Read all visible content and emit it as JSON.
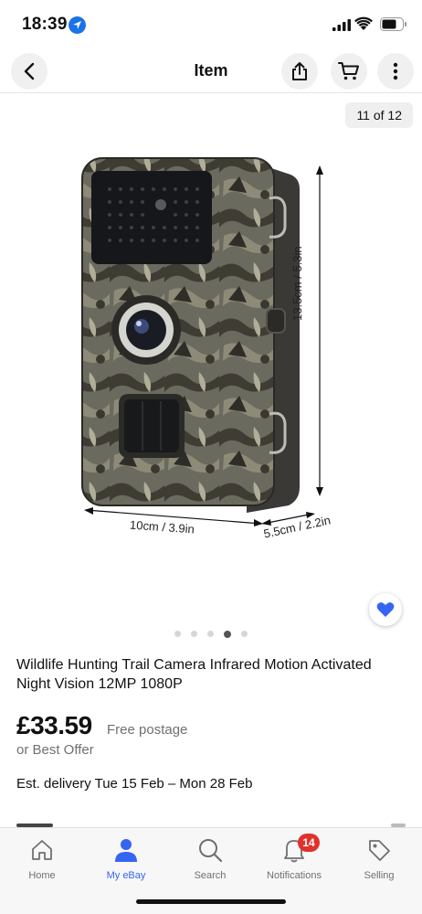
{
  "status_bar": {
    "time": "18:39"
  },
  "nav": {
    "title": "Item"
  },
  "gallery": {
    "counter": "11 of 12",
    "dimension_height": "13.5cm / 5.3in",
    "dimension_width": "10cm / 3.9in",
    "dimension_depth": "5.5cm / 2.2in",
    "dots_total": 5,
    "dots_active_index": 3
  },
  "listing": {
    "title": "Wildlife Hunting Trail Camera Infrared Motion Activated Night Vision 12MP 1080P",
    "price": "£33.59",
    "postage": "Free postage",
    "offer": "or Best Offer",
    "delivery_prefix": "Est. delivery ",
    "delivery_dates": "Tue 15 Feb – Mon 28 Feb"
  },
  "tabbar": {
    "tabs": [
      {
        "label": "Home",
        "icon": "home-icon"
      },
      {
        "label": "My eBay",
        "icon": "person-icon"
      },
      {
        "label": "Search",
        "icon": "search-icon"
      },
      {
        "label": "Notifications",
        "icon": "bell-icon"
      },
      {
        "label": "Selling",
        "icon": "tag-icon"
      }
    ],
    "active": "My eBay",
    "notifications_badge": "14"
  },
  "colors": {
    "accent": "#3665f3",
    "badge": "#e0312c",
    "location": "#1a73e8"
  }
}
